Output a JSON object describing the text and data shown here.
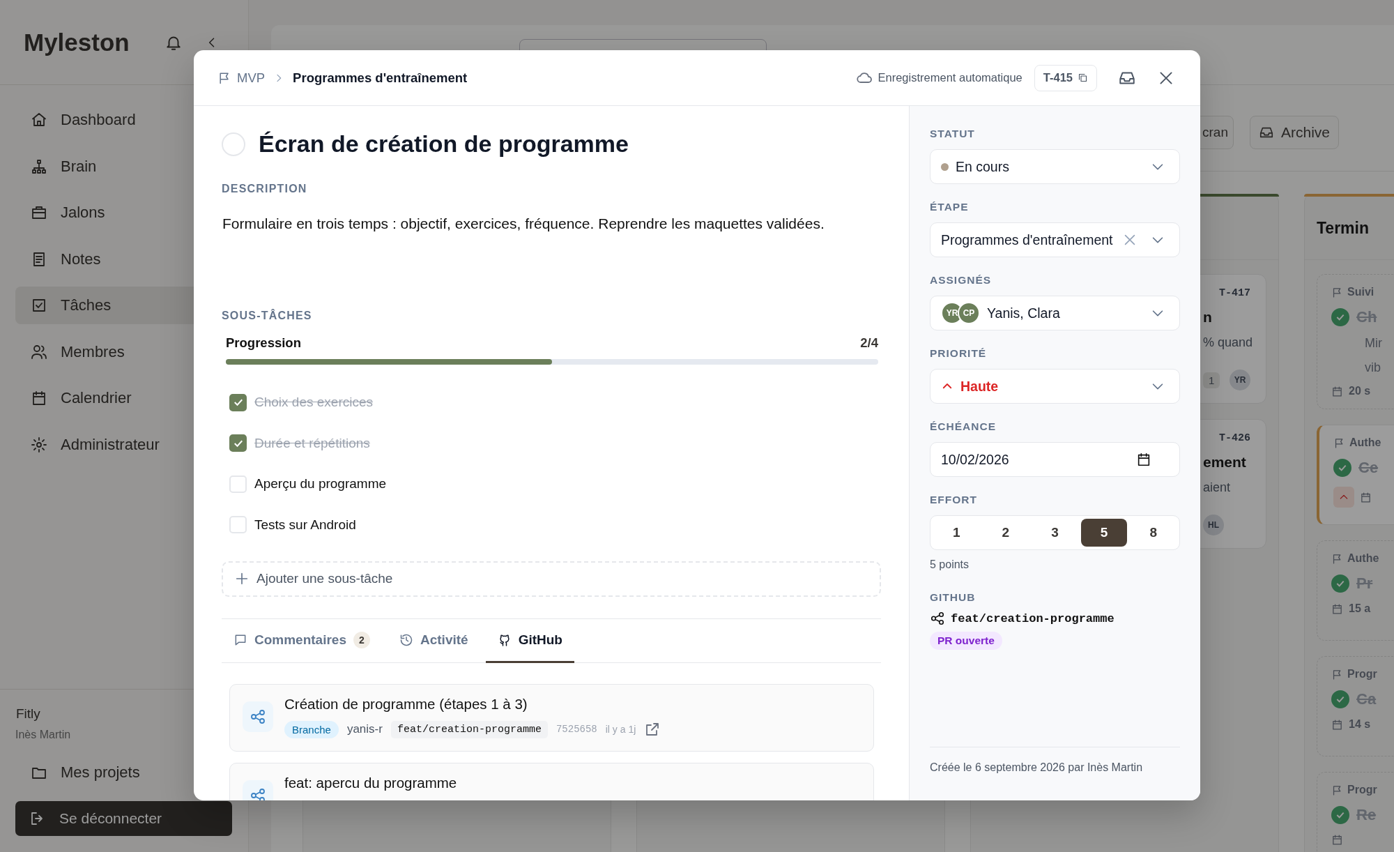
{
  "sidebar": {
    "logo": "Myleston",
    "nav": [
      {
        "label": "Dashboard",
        "selected": false
      },
      {
        "label": "Brain",
        "selected": false
      },
      {
        "label": "Jalons",
        "selected": false
      },
      {
        "label": "Notes",
        "selected": false
      },
      {
        "label": "Tâches",
        "selected": true
      },
      {
        "label": "Membres",
        "selected": false
      },
      {
        "label": "Calendrier",
        "selected": false
      },
      {
        "label": "Administrateur",
        "selected": false
      }
    ],
    "workspace": "Fitly",
    "user": "Inès Martin",
    "projects_link": "Mes projets",
    "logout_button": "Se déconnecter"
  },
  "board": {
    "toolbar": [
      {
        "label": "cran"
      },
      {
        "label": "Archive"
      }
    ],
    "columns": [
      {
        "color": "#3a492d",
        "cards": [
          {
            "kind": "ticket",
            "id": "T-417",
            "title": "n",
            "text": "% quand",
            "count": "1",
            "assignee": "YR"
          },
          {
            "kind": "ticket",
            "id": "T-426",
            "title": "ement",
            "text": "aient",
            "assignee": "HL"
          }
        ]
      },
      {
        "color": "#8a6533",
        "title": "Termin",
        "cards": [
          {
            "kind": "task",
            "tag": "Suivi",
            "title": "Ch",
            "done": true,
            "highlighted": false,
            "lines": [
              "Mir",
              "vib"
            ],
            "date": "20 s"
          },
          {
            "kind": "task",
            "tag": "Authe",
            "title": "Ce",
            "done": true,
            "highlighted": true,
            "high_priority": true
          },
          {
            "kind": "task",
            "tag": "Authe",
            "title": "Pr",
            "done": true,
            "highlighted": false,
            "date": "15 a"
          },
          {
            "kind": "task",
            "tag": "Progr",
            "title": "Ca",
            "done": true,
            "highlighted": false,
            "date": "14 s"
          },
          {
            "kind": "task",
            "tag": "Progr",
            "title": "Re",
            "done": true,
            "highlighted": false
          }
        ]
      }
    ]
  },
  "modal": {
    "breadcrumb": [
      {
        "label": "MVP",
        "current": false
      },
      {
        "label": "Programmes d'entraînement",
        "current": true
      }
    ],
    "autosave": "Enregistrement automatique",
    "task_id": "T-415",
    "task": {
      "title": "Écran de création de programme",
      "done": false
    },
    "description_label": "DESCRIPTION",
    "description": "Formulaire en trois temps : objectif, exercices, fréquence. Reprendre les maquettes validées.",
    "subtasks": {
      "label": "SOUS-TÂCHES",
      "progress_label": "Progression",
      "progress_count": "2/4",
      "level": 0.5,
      "items": [
        {
          "label": "Choix des exercices",
          "checked": true
        },
        {
          "label": "Durée et répétitions",
          "checked": true
        },
        {
          "label": "Aperçu du programme",
          "checked": false
        },
        {
          "label": "Tests sur Android",
          "checked": false
        }
      ],
      "add_button": "Ajouter une sous-tâche"
    },
    "tabs": [
      {
        "label": "Commentaires",
        "badge": "2",
        "selected": false
      },
      {
        "label": "Activité",
        "selected": false
      },
      {
        "label": "GitHub",
        "selected": true
      }
    ],
    "github_items": [
      {
        "title": "Création de programme (étapes 1 à 3)",
        "tag": "Branche",
        "author": "yanis-r",
        "branch": "feat/creation-programme",
        "commit": "7525658",
        "time": "il y a 1j"
      },
      {
        "title": "feat: apercu du programme"
      }
    ],
    "status": {
      "label": "STATUT",
      "value": "En cours",
      "color": "#b0a08e"
    },
    "stage": {
      "label": "ÉTAPE",
      "value": "Programmes d'entraînement",
      "clearable": true
    },
    "assignees": {
      "label": "ASSIGNÉS",
      "avatars": [
        "YR",
        "CP"
      ],
      "value": "Yanis, Clara"
    },
    "priority": {
      "label": "PRIORITÉ",
      "value": "Haute",
      "high": true
    },
    "due": {
      "label": "ÉCHÉANCE",
      "value": "10/02/2026"
    },
    "effort": {
      "label": "EFFORT",
      "options": [
        {
          "label": "1",
          "selected": false
        },
        {
          "label": "2",
          "selected": false
        },
        {
          "label": "3",
          "selected": false
        },
        {
          "label": "5",
          "selected": true
        },
        {
          "label": "8",
          "selected": false
        }
      ],
      "summary": "5 points"
    },
    "github": {
      "label": "GITHUB",
      "branch": "feat/creation-programme",
      "status": "PR ouverte"
    },
    "created": "Créée le 6 septembre 2026 par Inès Martin"
  }
}
